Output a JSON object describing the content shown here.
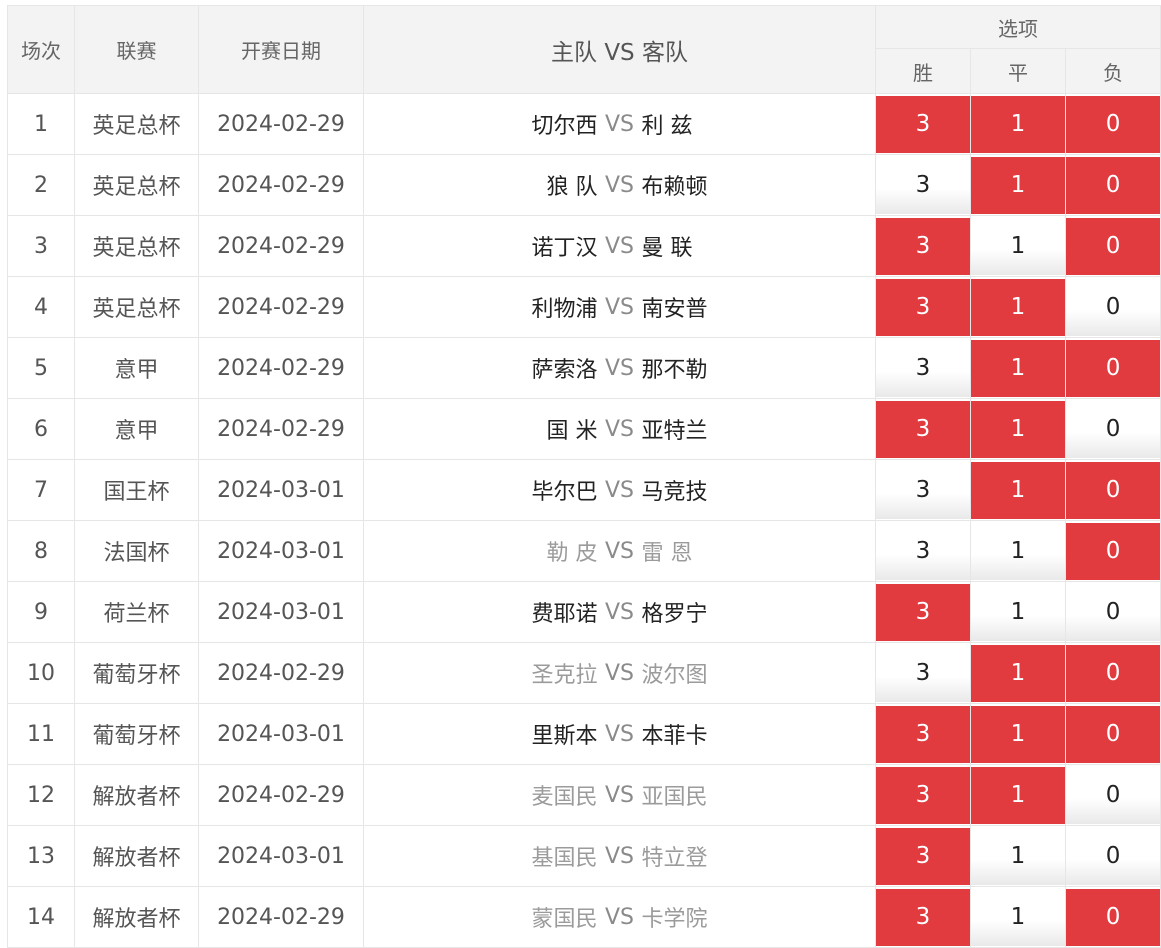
{
  "headers": {
    "index": "场次",
    "league": "联赛",
    "date": "开赛日期",
    "match": "主队 VS 客队",
    "options": "选项",
    "win": "胜",
    "draw": "平",
    "lose": "负"
  },
  "vs_label": "VS",
  "colors": {
    "selected": "#e13b3f",
    "header_bg": "#f3f3f3"
  },
  "rows": [
    {
      "index": "1",
      "league": "英足总杯",
      "date": "2024-02-29",
      "home": "切尔西",
      "away": "利 兹",
      "dim": false,
      "opts": [
        {
          "label": "3",
          "selected": true
        },
        {
          "label": "1",
          "selected": true
        },
        {
          "label": "0",
          "selected": true
        }
      ]
    },
    {
      "index": "2",
      "league": "英足总杯",
      "date": "2024-02-29",
      "home": "狼 队",
      "away": "布赖顿",
      "dim": false,
      "opts": [
        {
          "label": "3",
          "selected": false
        },
        {
          "label": "1",
          "selected": true
        },
        {
          "label": "0",
          "selected": true
        }
      ]
    },
    {
      "index": "3",
      "league": "英足总杯",
      "date": "2024-02-29",
      "home": "诺丁汉",
      "away": "曼 联",
      "dim": false,
      "opts": [
        {
          "label": "3",
          "selected": true
        },
        {
          "label": "1",
          "selected": false
        },
        {
          "label": "0",
          "selected": true
        }
      ]
    },
    {
      "index": "4",
      "league": "英足总杯",
      "date": "2024-02-29",
      "home": "利物浦",
      "away": "南安普",
      "dim": false,
      "opts": [
        {
          "label": "3",
          "selected": true
        },
        {
          "label": "1",
          "selected": true
        },
        {
          "label": "0",
          "selected": false
        }
      ]
    },
    {
      "index": "5",
      "league": "意甲",
      "date": "2024-02-29",
      "home": "萨索洛",
      "away": "那不勒",
      "dim": false,
      "opts": [
        {
          "label": "3",
          "selected": false
        },
        {
          "label": "1",
          "selected": true
        },
        {
          "label": "0",
          "selected": true
        }
      ]
    },
    {
      "index": "6",
      "league": "意甲",
      "date": "2024-02-29",
      "home": "国 米",
      "away": "亚特兰",
      "dim": false,
      "opts": [
        {
          "label": "3",
          "selected": true
        },
        {
          "label": "1",
          "selected": true
        },
        {
          "label": "0",
          "selected": false
        }
      ]
    },
    {
      "index": "7",
      "league": "国王杯",
      "date": "2024-03-01",
      "home": "毕尔巴",
      "away": "马竞技",
      "dim": false,
      "opts": [
        {
          "label": "3",
          "selected": false
        },
        {
          "label": "1",
          "selected": true
        },
        {
          "label": "0",
          "selected": true
        }
      ]
    },
    {
      "index": "8",
      "league": "法国杯",
      "date": "2024-03-01",
      "home": "勒 皮",
      "away": "雷 恩",
      "dim": true,
      "opts": [
        {
          "label": "3",
          "selected": false
        },
        {
          "label": "1",
          "selected": false
        },
        {
          "label": "0",
          "selected": true
        }
      ]
    },
    {
      "index": "9",
      "league": "荷兰杯",
      "date": "2024-03-01",
      "home": "费耶诺",
      "away": "格罗宁",
      "dim": false,
      "opts": [
        {
          "label": "3",
          "selected": true
        },
        {
          "label": "1",
          "selected": false
        },
        {
          "label": "0",
          "selected": false
        }
      ]
    },
    {
      "index": "10",
      "league": "葡萄牙杯",
      "date": "2024-02-29",
      "home": "圣克拉",
      "away": "波尔图",
      "dim": true,
      "opts": [
        {
          "label": "3",
          "selected": false
        },
        {
          "label": "1",
          "selected": true
        },
        {
          "label": "0",
          "selected": true
        }
      ]
    },
    {
      "index": "11",
      "league": "葡萄牙杯",
      "date": "2024-03-01",
      "home": "里斯本",
      "away": "本菲卡",
      "dim": false,
      "opts": [
        {
          "label": "3",
          "selected": true
        },
        {
          "label": "1",
          "selected": true
        },
        {
          "label": "0",
          "selected": true
        }
      ]
    },
    {
      "index": "12",
      "league": "解放者杯",
      "date": "2024-02-29",
      "home": "麦国民",
      "away": "亚国民",
      "dim": true,
      "opts": [
        {
          "label": "3",
          "selected": true
        },
        {
          "label": "1",
          "selected": true
        },
        {
          "label": "0",
          "selected": false
        }
      ]
    },
    {
      "index": "13",
      "league": "解放者杯",
      "date": "2024-03-01",
      "home": "基国民",
      "away": "特立登",
      "dim": true,
      "opts": [
        {
          "label": "3",
          "selected": true
        },
        {
          "label": "1",
          "selected": false
        },
        {
          "label": "0",
          "selected": false
        }
      ]
    },
    {
      "index": "14",
      "league": "解放者杯",
      "date": "2024-02-29",
      "home": "蒙国民",
      "away": "卡学院",
      "dim": true,
      "opts": [
        {
          "label": "3",
          "selected": true
        },
        {
          "label": "1",
          "selected": false
        },
        {
          "label": "0",
          "selected": true
        }
      ]
    }
  ]
}
